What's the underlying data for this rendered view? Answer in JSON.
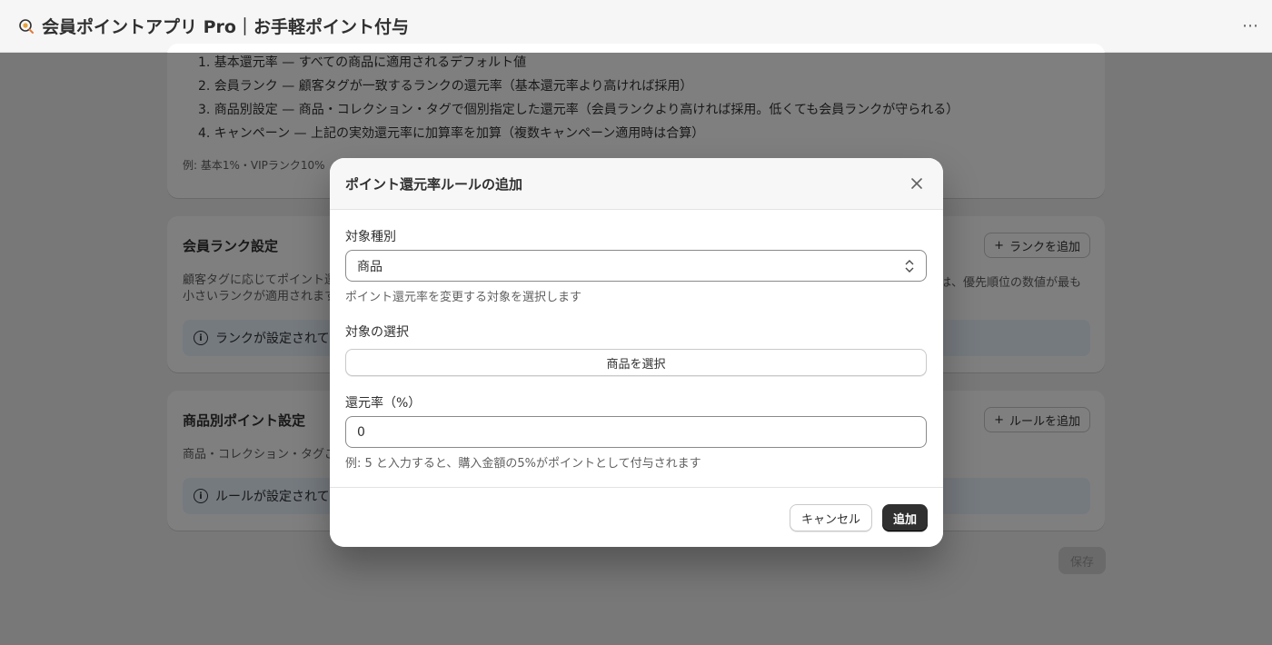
{
  "header": {
    "app_icon": "coin-search-icon",
    "title": "会員ポイントアプリ Pro｜お手軽ポイント付与",
    "more_icon": "more-horizontal-icon"
  },
  "priority_card": {
    "items": [
      "1. 基本還元率 — すべての商品に適用されるデフォルト値",
      "2. 会員ランク — 顧客タグが一致するランクの還元率（基本還元率より高ければ採用）",
      "3. 商品別設定 — 商品・コレクション・タグで個別指定した還元率（会員ランクより高ければ採用。低くても会員ランクが守られる）",
      "4. キャンペーン — 上記の実効還元率に加算率を加算（複数キャンペーン適用時は合算）"
    ],
    "example": "例: 基本1%・VIPランク10%"
  },
  "rank_card": {
    "title": "会員ランク設定",
    "add_button": "ランクを追加",
    "description_left": "顧客タグに応じてポイント還 小さいランクが適用されます",
    "description_right": "は、優先順位の数値が最も",
    "banner": "ランクが設定されて"
  },
  "product_card": {
    "title": "商品別ポイント設定",
    "add_button": "ルールを追加",
    "description": "商品・コレクション・タグご",
    "banner": "ルールが設定されて"
  },
  "save_button": "保存",
  "modal": {
    "title": "ポイント還元率ルールの追加",
    "target_type_label": "対象種別",
    "target_type_value": "商品",
    "target_type_help": "ポイント還元率を変更する対象を選択します",
    "target_select_label": "対象の選択",
    "select_product_button": "商品を選択",
    "rate_label": "還元率（%）",
    "rate_value": "0",
    "rate_help": "例: 5 と入力すると、購入金額の5%がポイントとして付与されます",
    "cancel_button": "キャンセル",
    "add_button": "追加"
  }
}
